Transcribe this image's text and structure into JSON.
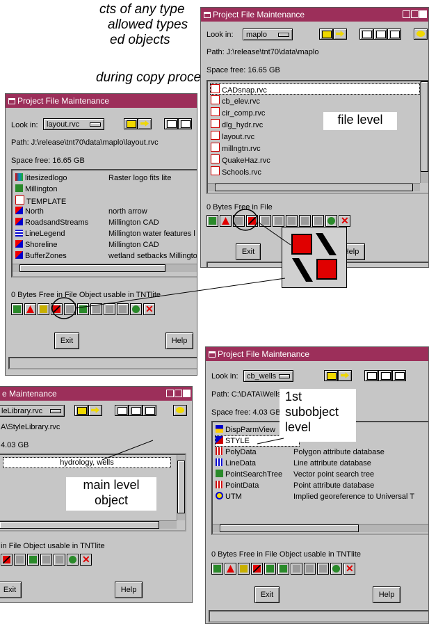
{
  "captions": [
    "cts of any type",
    "allowed types",
    "ed objects",
    "during copy process"
  ],
  "window_title": "Project File Maintenance",
  "look_in_label": "Look in:",
  "path_prefix": "Path:",
  "space_prefix": "Space free:",
  "exit_label": "Exit",
  "help_label": "Help",
  "bytes_free": "0 Bytes Free in File",
  "tntlite_note": "Object usable in TNTlite",
  "w1": {
    "look_in": "maplo",
    "path": "J:\\release\\tnt70\\data\\maplo",
    "space": "16.65 GB",
    "files": [
      "CADsnap.rvc",
      "cb_elev.rvc",
      "cir_comp.rvc",
      "dlg_hydr.rvc",
      "layout.rvc",
      "millngtn.rvc",
      "QuakeHaz.rvc",
      "Schools.rvc"
    ],
    "annotation": "file level"
  },
  "w2": {
    "look_in": "layout.rvc",
    "path": "J:\\release\\tnt70\\data\\maplo\\layout.rvc",
    "space": "16.65 GB",
    "items": [
      {
        "name": "litesizedlogo",
        "desc": "Raster logo fits lite"
      },
      {
        "name": "Millington",
        "desc": ""
      },
      {
        "name": "TEMPLATE",
        "desc": ""
      },
      {
        "name": "North",
        "desc": "north arrow"
      },
      {
        "name": "RoadsandStreams",
        "desc": "Millington CAD"
      },
      {
        "name": "LineLegend",
        "desc": "Millington water features l"
      },
      {
        "name": "Shoreline",
        "desc": "Millington CAD"
      },
      {
        "name": "BufferZones",
        "desc": "wetland setbacks Millingto"
      }
    ]
  },
  "w3": {
    "look_in": "cb_wells",
    "path": "C:\\DATA\\Wells.rvc",
    "space": "4.03 GB",
    "items": [
      {
        "name": "DispParmView",
        "desc": ""
      },
      {
        "name": "STYLE",
        "desc": ""
      },
      {
        "name": "PolyData",
        "desc": "Polygon attribute database"
      },
      {
        "name": "LineData",
        "desc": "Line attribute database"
      },
      {
        "name": "PointSearchTree",
        "desc": "Vector point search tree"
      },
      {
        "name": "PointData",
        "desc": "Point attribute database"
      },
      {
        "name": "UTM",
        "desc": "Implied georeference to Universal T"
      }
    ],
    "annotation": [
      "1st",
      "subobject",
      "level"
    ]
  },
  "w4": {
    "title_partial": "e Maintenance",
    "look_in": "leLibrary.rvc",
    "path": "A\\StyleLibrary.rvc",
    "space": "4.03 GB",
    "item": "hydrology, wells",
    "bytes_free": "in File",
    "annotation": [
      "main level",
      "object"
    ]
  },
  "colors": {
    "titlebar": "#9c2f5a",
    "window": "#c6c6c6",
    "highlight_red": "#e00000"
  }
}
